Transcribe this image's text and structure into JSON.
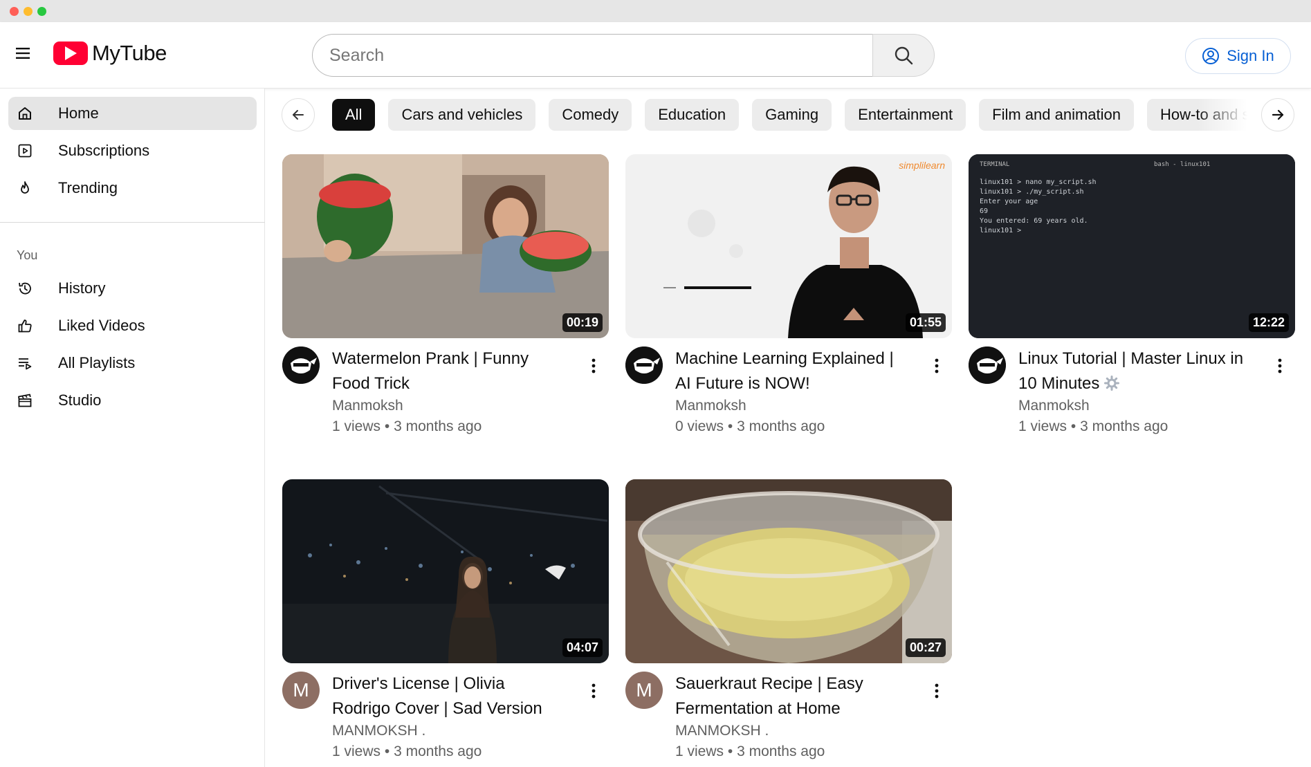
{
  "header": {
    "logo_text": "MyTube",
    "search_placeholder": "Search",
    "sign_in_label": "Sign In"
  },
  "sidebar": {
    "items": [
      {
        "label": "Home",
        "icon": "home-icon",
        "active": true
      },
      {
        "label": "Subscriptions",
        "icon": "subscriptions-icon"
      },
      {
        "label": "Trending",
        "icon": "flame-icon"
      }
    ],
    "section_title": "You",
    "you_items": [
      {
        "label": "History",
        "icon": "history-icon"
      },
      {
        "label": "Liked Videos",
        "icon": "thumbs-up-icon"
      },
      {
        "label": "All Playlists",
        "icon": "playlist-icon"
      },
      {
        "label": "Studio",
        "icon": "clapperboard-icon"
      }
    ]
  },
  "chips": [
    "All",
    "Cars and vehicles",
    "Comedy",
    "Education",
    "Gaming",
    "Entertainment",
    "Film and animation",
    "How-to and style"
  ],
  "videos": [
    {
      "title": "Watermelon Prank | Funny Food Trick",
      "channel": "Manmoksh",
      "views": "1 views",
      "age": "3 months ago",
      "duration": "00:19",
      "avatar": "ninja"
    },
    {
      "title": "Machine Learning Explained | AI Future is NOW!",
      "channel": "Manmoksh",
      "views": "0 views",
      "age": "3 months ago",
      "duration": "01:55",
      "avatar": "ninja"
    },
    {
      "title": "Linux Tutorial | Master Linux in 10 Minutes",
      "channel": "Manmoksh",
      "views": "1 views",
      "age": "3 months ago",
      "duration": "12:22",
      "avatar": "ninja"
    },
    {
      "title": "Driver's License | Olivia Rodrigo Cover | Sad Version",
      "channel": "MANMOKSH .",
      "views": "1 views",
      "age": "3 months ago",
      "duration": "04:07",
      "avatar": "M"
    },
    {
      "title": "Sauerkraut Recipe | Easy Fermentation at Home",
      "channel": "MANMOKSH .",
      "views": "1 views",
      "age": "3 months ago",
      "duration": "00:27",
      "avatar": "M"
    }
  ],
  "thumb_text": {
    "brand_watermark": "simplilearn",
    "terminal_tab": "TERMINAL",
    "terminal_shell": "bash - linux101",
    "terminal_lines": [
      "linux101 > nano my_script.sh",
      "linux101 > ./my_script.sh",
      "Enter your age",
      "69",
      "You entered: 69 years old.",
      "linux101 >"
    ]
  },
  "colors": {
    "brand": "#ff0033",
    "accent": "#065fd4",
    "chip_active": "#0f0f0f",
    "chip": "#ececec"
  }
}
